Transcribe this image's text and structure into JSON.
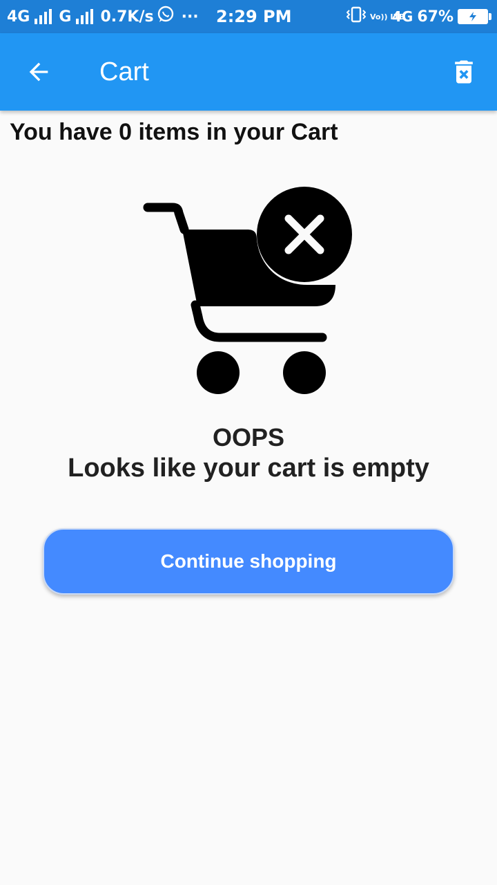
{
  "status_bar": {
    "network_1": "4G",
    "network_2": "G",
    "speed": "0.7K/s",
    "more": "···",
    "time": "2:29 PM",
    "volte": "Vo)) LTE",
    "network_3": "4G",
    "battery_percent": "67%",
    "battery_level": 0.67,
    "icons": [
      "signal-icon",
      "whatsapp-icon",
      "vibrate-icon",
      "battery-charging-icon"
    ]
  },
  "app_bar": {
    "title": "Cart",
    "back_icon": "arrow-back-icon",
    "action_icon": "delete-forever-icon",
    "color": "#2196f3"
  },
  "cart": {
    "count_prefix": "You have ",
    "count": "0",
    "count_suffix": " items in your Cart",
    "illustration_icon": "empty-cart-icon",
    "oops_text": "OOPS",
    "empty_message": "Looks like your cart is empty",
    "continue_label": "Continue shopping",
    "button_color": "#448aff"
  }
}
